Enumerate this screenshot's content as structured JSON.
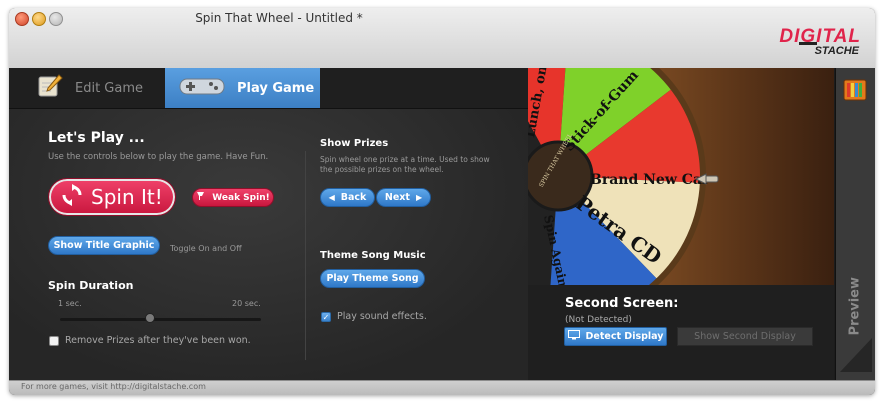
{
  "window": {
    "title": "Spin That Wheel - Untitled *"
  },
  "brand": {
    "line1": "DIGITAL",
    "line2": "STACHE"
  },
  "tabs": [
    {
      "label": "Edit Game",
      "icon": "edit-pencil-icon",
      "active": false
    },
    {
      "label": "Play Game",
      "icon": "gamepad-icon",
      "active": true
    }
  ],
  "play": {
    "title": "Let's Play ...",
    "subtitle": "Use the controls below to play the game. Have Fun.",
    "spin_label": "Spin It!",
    "weak_spin_label": "Weak Spin!",
    "show_title_label": "Show Title Graphic",
    "toggle_hint": "Toggle On and Off",
    "spin_duration": {
      "title": "Spin Duration",
      "min_label": "1 sec.",
      "max_label": "20 sec.",
      "value_fraction": 0.45
    },
    "remove_prizes": {
      "label": "Remove Prizes after they've been won.",
      "checked": false
    }
  },
  "prizes": {
    "title": "Show Prizes",
    "description_line1": "Spin wheel one prize at a time. Used to show",
    "description_line2": "the possible prizes on the wheel.",
    "back_label": "Back",
    "next_label": "Next"
  },
  "music": {
    "title": "Theme Song Music",
    "play_label": "Play Theme Song",
    "sound_effects": {
      "label": "Play sound effects.",
      "checked": true
    }
  },
  "wheel": {
    "hub_text": "SPIN THAT WHEEL",
    "segments": [
      {
        "label": "Lunch, on",
        "color": "#e7342b"
      },
      {
        "label": "Stick-of-Gum",
        "color": "#7fd12a"
      },
      {
        "label": "Brand New Car",
        "color": "#e8392e"
      },
      {
        "label": "Petra CD",
        "color": "#efe2b9"
      },
      {
        "label": "Spin Again",
        "color": "#2f66c8"
      }
    ]
  },
  "second_screen": {
    "title": "Second Screen:",
    "status": "(Not Detected)",
    "detect_label": "Detect Display",
    "show_label": "Show Second Display"
  },
  "preview": {
    "label": "Preview"
  },
  "footer": {
    "text": "For more games, visit http://digitalstache.com"
  },
  "colors": {
    "accent_blue": "#3c7fc4",
    "accent_red": "#d81e47"
  }
}
